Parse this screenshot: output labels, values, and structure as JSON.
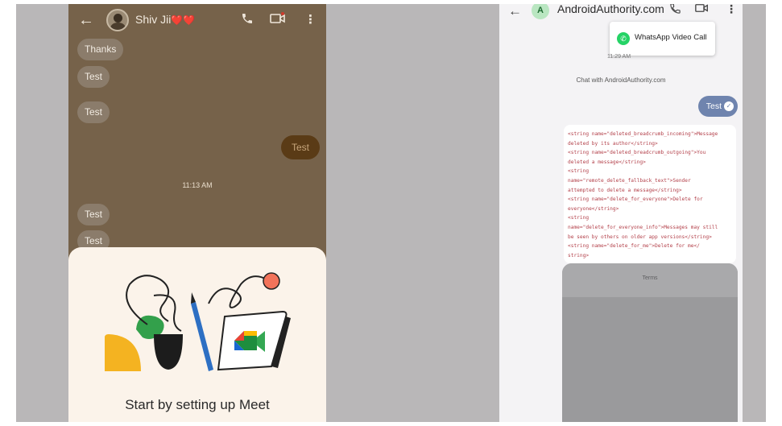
{
  "left_phone": {
    "contact_name": "Shiv Jii",
    "contact_emoji": "❤️❤️",
    "messages_in_top": [
      "Thanks",
      "Test",
      "Test"
    ],
    "message_out": "Test",
    "time_divider": "11:13 AM",
    "messages_in_bottom": [
      "Test",
      "Test"
    ],
    "meet_sheet_title": "Start by setting up Meet"
  },
  "right_phone": {
    "contact_initial": "A",
    "contact_name": "AndroidAuthority.com",
    "popup_label": "WhatsApp Video Call",
    "small_time": "11:29 AM",
    "chat_info": "Chat with AndroidAuthority.com",
    "message_out": "Test",
    "code_lines": [
      "<string name=\"deleted_breadcrumb_incoming\">Message",
      "deleted by its author</string>",
      "    <string name=\"deleted_breadcrumb_outgoing\">You",
      "deleted a message</string>",
      "    <string",
      "name=\"remote_delete_fallback_text\">Sender",
      "attempted to delete a message</string>",
      "  <string name=\"delete_for_everyone\">Delete for",
      "everyone</string>",
      "    <string",
      "name=\"delete_for_everyone_info\">Messages may still",
      "be seen by others on older app versions</string>",
      "    <string name=\"delete_for_me\">Delete for me</",
      "string>"
    ],
    "gray_panel_label": "Terms"
  }
}
